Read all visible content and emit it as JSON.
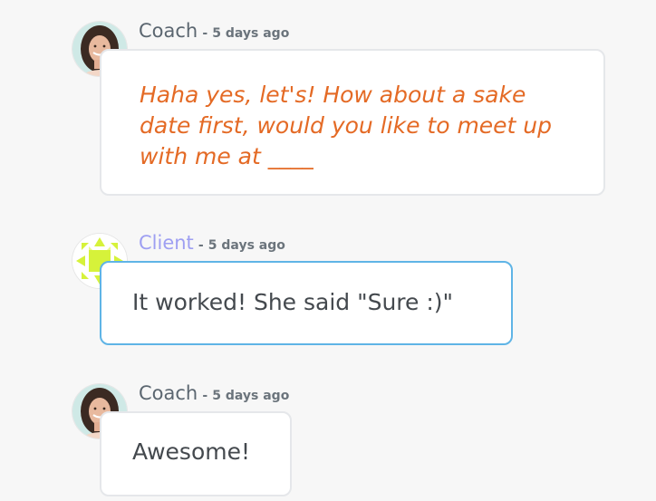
{
  "messages": [
    {
      "author": "Coach",
      "time": "5 days ago",
      "text": "Haha yes, let's! How about a sake date first, would you like to meet up with me at ____",
      "text_lines": [
        "Haha yes, let's! How about a sake",
        "date first, would you like to meet up",
        "with me at ____"
      ]
    },
    {
      "author": "Client",
      "time": "5 days ago",
      "text": "It worked! She said \"Sure :)\""
    },
    {
      "author": "Coach",
      "time": "5 days ago",
      "text": "Awesome!"
    }
  ],
  "separator": "-",
  "colors": {
    "coach_name": "#5b6670",
    "client_name": "#9e9ff2",
    "emphasis_text": "#e46a25",
    "client_bubble_border": "#5fb4e6",
    "client_avatar": "#d6f23a"
  },
  "icons": {
    "coach_avatar": "coach-avatar-photo",
    "client_avatar": "client-geometric-avatar"
  }
}
